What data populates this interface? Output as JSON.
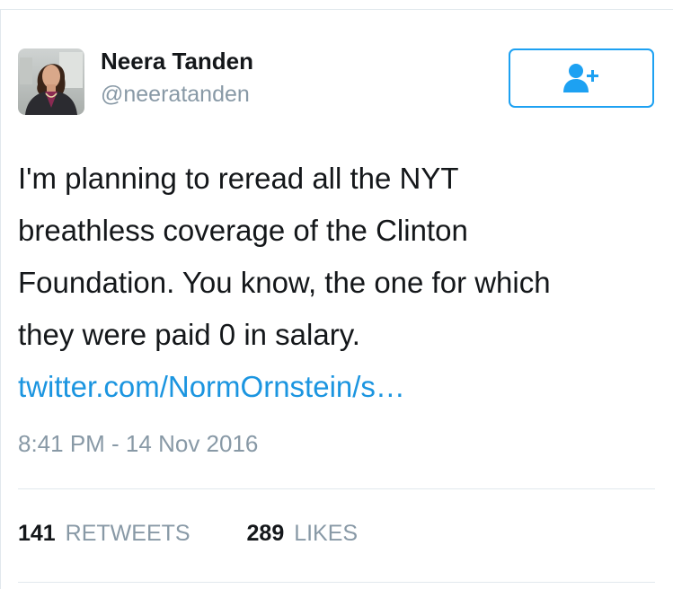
{
  "author": {
    "name": "Neera Tanden",
    "handle": "@neeratanden",
    "avatar_icon": "profile-photo"
  },
  "follow_button": {
    "icon": "add-user-icon",
    "accent": "#1da1f2"
  },
  "tweet": {
    "lines": [
      "I'm planning to reread all the NYT",
      "breathless coverage of the Clinton",
      "Foundation. You know, the one for which",
      "they were paid 0 in salary."
    ],
    "link": "twitter.com/NormOrnstein/s…",
    "link_color": "#1b95e0"
  },
  "timestamp": "8:41 PM - 14 Nov 2016",
  "stats": {
    "retweets_count": "141",
    "retweets_label": "RETWEETS",
    "likes_count": "289",
    "likes_label": "LIKES"
  }
}
